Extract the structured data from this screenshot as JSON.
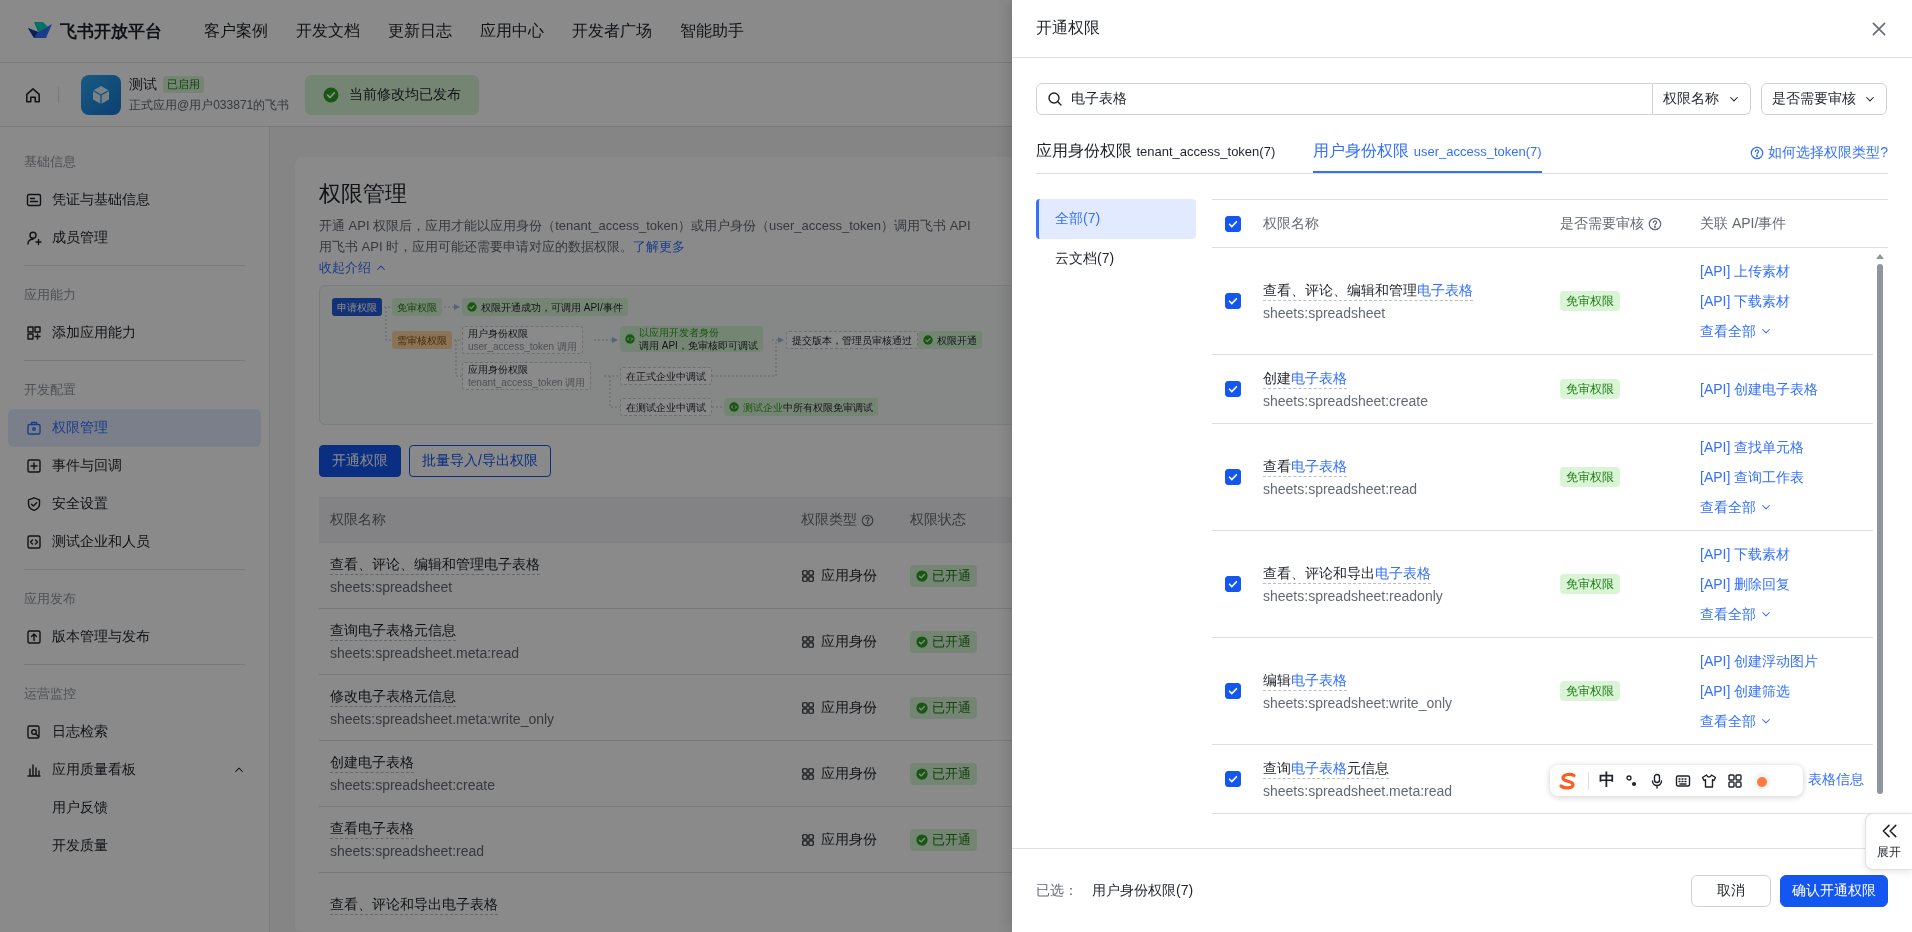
{
  "top_nav": {
    "brand": "飞书开放平台",
    "items": [
      "客户案例",
      "开发文档",
      "更新日志",
      "应用中心",
      "开发者广场",
      "智能助手"
    ]
  },
  "app_bar": {
    "app_name": "测试",
    "app_status": "已启用",
    "app_owner": "正式应用@用户033871的飞书",
    "publish_notice": "当前修改均已发布"
  },
  "sidebar": {
    "groups": [
      {
        "title": "基础信息",
        "items": [
          {
            "label": "凭证与基础信息",
            "selected": false
          },
          {
            "label": "成员管理",
            "selected": false
          }
        ]
      },
      {
        "title": "应用能力",
        "items": [
          {
            "label": "添加应用能力",
            "selected": false
          }
        ]
      },
      {
        "title": "开发配置",
        "items": [
          {
            "label": "权限管理",
            "selected": true
          },
          {
            "label": "事件与回调",
            "selected": false
          },
          {
            "label": "安全设置",
            "selected": false
          },
          {
            "label": "测试企业和人员",
            "selected": false
          }
        ]
      },
      {
        "title": "应用发布",
        "items": [
          {
            "label": "版本管理与发布",
            "selected": false
          }
        ]
      },
      {
        "title": "运营监控",
        "items": [
          {
            "label": "日志检索",
            "selected": false
          },
          {
            "label": "应用质量看板",
            "selected": false,
            "expanded": true,
            "children": [
              {
                "label": "用户反馈",
                "selected": false
              },
              {
                "label": "开发质量",
                "selected": false
              }
            ]
          }
        ]
      }
    ]
  },
  "page": {
    "title": "权限管理",
    "description_line_1": "开通 API 权限后，应用才能以应用身份（tenant_access_token）或用户身份（user_access_token）调用飞书 API",
    "description_line_2": "用飞书 API 时，应用可能还需要申请对应的数据权限。",
    "learn_more": "了解更多",
    "collapse_intro": "收起介绍",
    "flow": [
      {
        "kind": "start",
        "text": "申请权限"
      },
      {
        "kind": "free",
        "text": "免审权限"
      },
      {
        "kind": "success",
        "text": "权限开通成功，可调用 API/事件"
      },
      {
        "kind": "review",
        "text": "需审核权限"
      },
      {
        "kind": "box",
        "text": "用户身份权限",
        "note": "user_access_token 调用"
      },
      {
        "kind": "debug",
        "highlight": "以应用开发者身份",
        "text": "调用 API，免审核即可调试"
      },
      {
        "kind": "step",
        "text": "提交版本，管理员审核通过"
      },
      {
        "kind": "success",
        "text": "权限开通"
      },
      {
        "kind": "box",
        "text": "应用身份权限",
        "note": "tenant_access_token 调用"
      },
      {
        "kind": "step",
        "text": "在正式企业中调试"
      },
      {
        "kind": "step",
        "text": "在测试企业中调试"
      },
      {
        "kind": "debug",
        "highlight": "测试企业",
        "text": "中所有权限免审调试"
      }
    ],
    "buttons": [
      "开通权限",
      "批量导入/导出权限"
    ],
    "table": {
      "columns": [
        "权限名称",
        "权限类型",
        "权限状态"
      ],
      "rows": [
        {
          "name": "查看、评论、编辑和管理电子表格",
          "code": "sheets:spreadsheet",
          "type": "应用身份",
          "status": "已开通"
        },
        {
          "name": "查询电子表格元信息",
          "code": "sheets:spreadsheet.meta:read",
          "type": "应用身份",
          "status": "已开通"
        },
        {
          "name": "修改电子表格元信息",
          "code": "sheets:spreadsheet.meta:write_only",
          "type": "应用身份",
          "status": "已开通"
        },
        {
          "name": "创建电子表格",
          "code": "sheets:spreadsheet:create",
          "type": "应用身份",
          "status": "已开通"
        },
        {
          "name": "查看电子表格",
          "code": "sheets:spreadsheet:read",
          "type": "应用身份",
          "status": "已开通"
        },
        {
          "name": "查看、评论和导出电子表格"
        }
      ]
    }
  },
  "drawer": {
    "title": "开通权限",
    "search": {
      "value": "电子表格",
      "field": "权限名称",
      "filter": "是否需要审核"
    },
    "tabs": [
      {
        "label": "应用身份权限",
        "token": "tenant_access_token(7)",
        "selected": false
      },
      {
        "label": "用户身份权限",
        "token": "user_access_token(7)",
        "selected": true
      }
    ],
    "help_link": "如何选择权限类型?",
    "categories": [
      {
        "label": "全部(7)",
        "selected": true
      },
      {
        "label": "云文档(7)",
        "selected": false
      }
    ],
    "table": {
      "all_checked": true,
      "columns": [
        "权限名称",
        "是否需要审核",
        "关联 API/事件"
      ],
      "rows": [
        {
          "checked": true,
          "name": [
            {
              "text": "查看、评论、编辑和管理",
              "highlight": false
            },
            {
              "text": "电子表格",
              "highlight": true
            }
          ],
          "code": "sheets:spreadsheet",
          "review": "免审权限",
          "apis": [
            "[API] 上传素材",
            "[API] 下载素材"
          ],
          "view_all": "查看全部"
        },
        {
          "checked": true,
          "name": [
            {
              "text": "创建",
              "highlight": false
            },
            {
              "text": "电子表格",
              "highlight": true
            }
          ],
          "code": "sheets:spreadsheet:create",
          "review": "免审权限",
          "apis": [
            "[API] 创建电子表格"
          ]
        },
        {
          "checked": true,
          "name": [
            {
              "text": "查看",
              "highlight": false
            },
            {
              "text": "电子表格",
              "highlight": true
            }
          ],
          "code": "sheets:spreadsheet:read",
          "review": "免审权限",
          "apis": [
            "[API] 查找单元格",
            "[API] 查询工作表"
          ],
          "view_all": "查看全部"
        },
        {
          "checked": true,
          "name": [
            {
              "text": "查看、评论和导出",
              "highlight": false
            },
            {
              "text": "电子表格",
              "highlight": true
            }
          ],
          "code": "sheets:spreadsheet:readonly",
          "review": "免审权限",
          "apis": [
            "[API] 下载素材",
            "[API] 删除回复"
          ],
          "view_all": "查看全部"
        },
        {
          "checked": true,
          "name": [
            {
              "text": "编辑",
              "highlight": false
            },
            {
              "text": "电子表格",
              "highlight": true
            }
          ],
          "code": "sheets:spreadsheet:write_only",
          "review": "免审权限",
          "apis": [
            "[API] 创建浮动图片",
            "[API] 创建筛选"
          ],
          "view_all": "查看全部"
        },
        {
          "checked": true,
          "name": [
            {
              "text": "查询",
              "highlight": false
            },
            {
              "text": "电子表格",
              "highlight": true
            },
            {
              "text": "元信息",
              "highlight": false
            }
          ],
          "code": "sheets:spreadsheet.meta:read",
          "apis": [
            "表格信息"
          ],
          "api_covered": true
        }
      ]
    },
    "footer": {
      "selected_label": "已选：",
      "selected_value": "用户身份权限(7)",
      "buttons": [
        "取消",
        "确认开通权限"
      ]
    }
  },
  "ime_toolbar": {
    "mode": "中"
  },
  "expand_button": "展开"
}
